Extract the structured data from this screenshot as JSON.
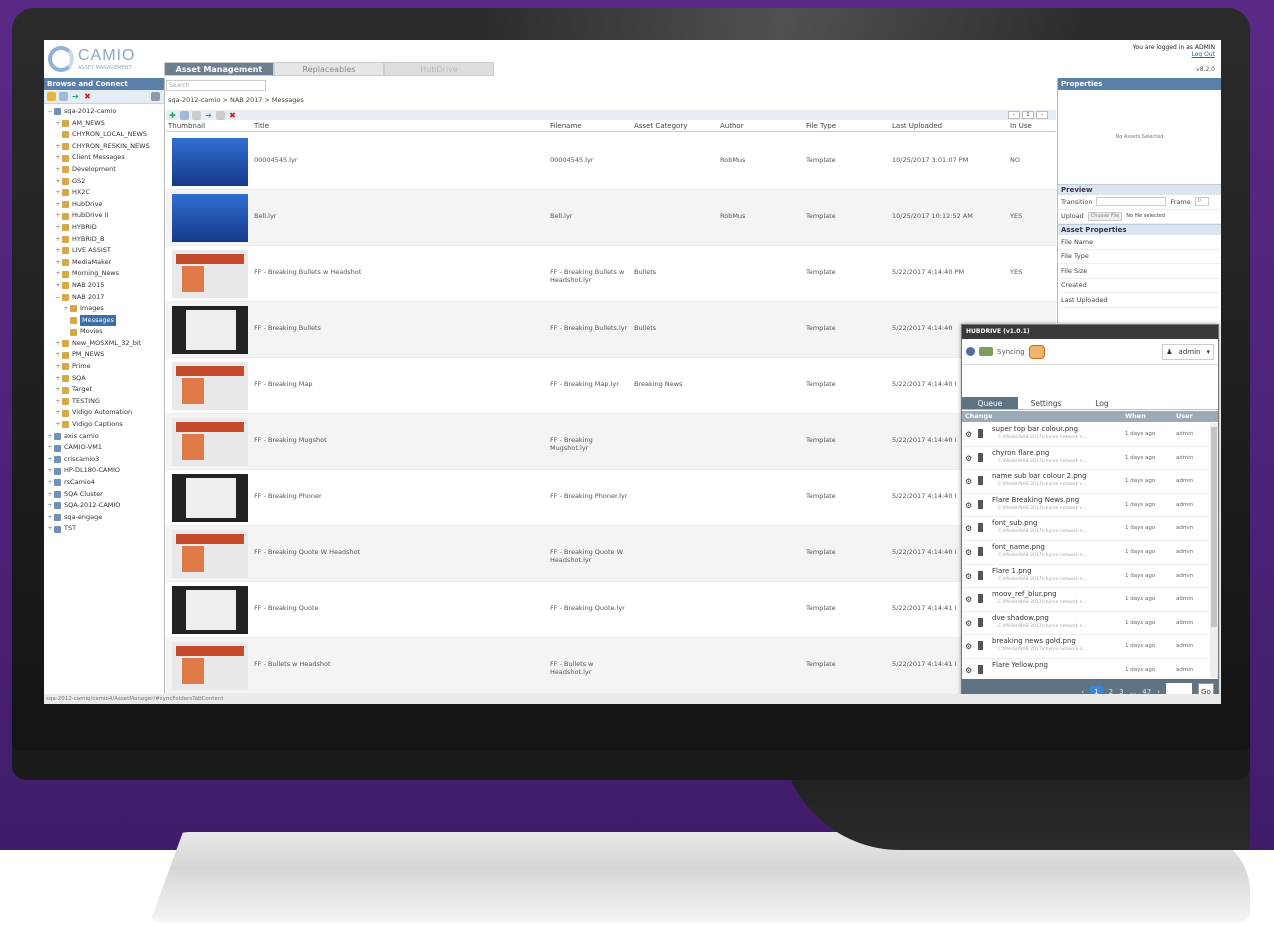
{
  "app": {
    "logo_name": "CAMIO",
    "logo_sub": "ASSET MANAGEMENT",
    "login_text": "You are logged in as ADMIN",
    "logout_label": "Log Out",
    "version": "v8.2.0"
  },
  "tabs": [
    {
      "label": "Asset Management"
    },
    {
      "label": "Replaceables"
    },
    {
      "label": "HubDrive"
    }
  ],
  "left_panel": {
    "title": "Browse and Connect",
    "tree": [
      {
        "label": "sqa-2012-camio",
        "level": 0,
        "type": "server",
        "exp": "−"
      },
      {
        "label": "AM_NEWS",
        "level": 1,
        "type": "folder",
        "exp": "+"
      },
      {
        "label": "CHYRON_LOCAL_NEWS",
        "level": 1,
        "type": "folder",
        "exp": ""
      },
      {
        "label": "CHYRON_RESKIN_NEWS",
        "level": 1,
        "type": "folder",
        "exp": "+"
      },
      {
        "label": "Client Messages",
        "level": 1,
        "type": "folder",
        "exp": "+"
      },
      {
        "label": "Development",
        "level": 1,
        "type": "folder",
        "exp": "+"
      },
      {
        "label": "GS2",
        "level": 1,
        "type": "folder",
        "exp": "+"
      },
      {
        "label": "HX2C",
        "level": 1,
        "type": "folder",
        "exp": "+"
      },
      {
        "label": "HubDrive",
        "level": 1,
        "type": "folder",
        "exp": "+"
      },
      {
        "label": "HubDrive II",
        "level": 1,
        "type": "folder",
        "exp": "+"
      },
      {
        "label": "HYBRID",
        "level": 1,
        "type": "folder",
        "exp": "+"
      },
      {
        "label": "HYBRID_B",
        "level": 1,
        "type": "folder",
        "exp": "+"
      },
      {
        "label": "LIVE ASSIST",
        "level": 1,
        "type": "folder",
        "exp": "+"
      },
      {
        "label": "MediaMaker",
        "level": 1,
        "type": "folder",
        "exp": "+"
      },
      {
        "label": "Morning_News",
        "level": 1,
        "type": "folder",
        "exp": "+"
      },
      {
        "label": "NAB 2015",
        "level": 1,
        "type": "folder",
        "exp": "+"
      },
      {
        "label": "NAB 2017",
        "level": 1,
        "type": "folder",
        "exp": "−"
      },
      {
        "label": "Images",
        "level": 2,
        "type": "folder",
        "exp": "+"
      },
      {
        "label": "Messages",
        "level": 2,
        "type": "folder",
        "exp": "",
        "selected": true
      },
      {
        "label": "Movies",
        "level": 2,
        "type": "folder",
        "exp": ""
      },
      {
        "label": "New_MOSXML_32_bit",
        "level": 1,
        "type": "folder",
        "exp": "+"
      },
      {
        "label": "PM_NEWS",
        "level": 1,
        "type": "folder",
        "exp": "+"
      },
      {
        "label": "Prime",
        "level": 1,
        "type": "folder",
        "exp": "+"
      },
      {
        "label": "SQA",
        "level": 1,
        "type": "folder",
        "exp": "+"
      },
      {
        "label": "Target",
        "level": 1,
        "type": "folder",
        "exp": "+"
      },
      {
        "label": "TESTING",
        "level": 1,
        "type": "folder",
        "exp": "+"
      },
      {
        "label": "Vidigo Automation",
        "level": 1,
        "type": "folder",
        "exp": "+"
      },
      {
        "label": "Vidigo Captions",
        "level": 1,
        "type": "folder",
        "exp": "+"
      },
      {
        "label": "axis camio",
        "level": 0,
        "type": "server",
        "exp": "+"
      },
      {
        "label": "CAMIO-VM1",
        "level": 0,
        "type": "server",
        "exp": "+"
      },
      {
        "label": "criscamio3",
        "level": 0,
        "type": "server",
        "exp": "+"
      },
      {
        "label": "HP-DL180-CAMIO",
        "level": 0,
        "type": "server",
        "exp": "+"
      },
      {
        "label": "rsCamio4",
        "level": 0,
        "type": "server",
        "exp": "+"
      },
      {
        "label": "SQA Cluster",
        "level": 0,
        "type": "server",
        "exp": "+"
      },
      {
        "label": "SQA-2012-CAMIO",
        "level": 0,
        "type": "server",
        "exp": "+"
      },
      {
        "label": "sqa-engage",
        "level": 0,
        "type": "server",
        "exp": "+"
      },
      {
        "label": "TST",
        "level": 0,
        "type": "server",
        "exp": "+"
      }
    ]
  },
  "center": {
    "search_placeholder": "Search",
    "breadcrumb": "sqa-2012-camio  >  NAB 2017  >  Messages",
    "columns": {
      "thumbnail": "Thumbnail",
      "title": "Title",
      "filename": "Filename",
      "category": "Asset Category",
      "author": "Author",
      "filetype": "File Type",
      "uploaded": "Last Uploaded",
      "inuse": "In Use"
    },
    "rows": [
      {
        "title": "00004545.lyr",
        "filename": "00004545.lyr",
        "category": "",
        "author": "RobMus",
        "filetype": "Template",
        "uploaded": "10/25/2017 3:01:07 PM",
        "inuse": "NO",
        "thumb": "blue"
      },
      {
        "title": "Bell.lyr",
        "filename": "Bell.lyr",
        "category": "",
        "author": "RobMus",
        "filetype": "Template",
        "uploaded": "10/25/2017 10:12:52 AM",
        "inuse": "YES",
        "thumb": "blue"
      },
      {
        "title": "FF - Breaking Bullets w Headshot",
        "filename": "FF - Breaking Bullets w Headshot.lyr",
        "category": "Bullets",
        "author": "",
        "filetype": "Template",
        "uploaded": "5/22/2017 4:14:40 PM",
        "inuse": "YES",
        "thumb": "tmpl"
      },
      {
        "title": "FF - Breaking Bullets",
        "filename": "FF - Breaking Bullets.lyr",
        "category": "Bullets",
        "author": "",
        "filetype": "Template",
        "uploaded": "5/22/2017 4:14:40",
        "inuse": "",
        "thumb": "dark"
      },
      {
        "title": "FF - Breaking Map",
        "filename": "FF - Breaking Map.lyr",
        "category": "Breaking News",
        "author": "",
        "filetype": "Template",
        "uploaded": "5/22/2017 4:14:40 I",
        "inuse": "",
        "thumb": "tmpl"
      },
      {
        "title": "FF - Breaking Mugshot",
        "filename": "FF - Breaking Mugshot.lyr",
        "category": "",
        "author": "",
        "filetype": "Template",
        "uploaded": "5/22/2017 4:14:40 I",
        "inuse": "",
        "thumb": "tmpl"
      },
      {
        "title": "FF - Breaking Phoner",
        "filename": "FF - Breaking Phoner.lyr",
        "category": "",
        "author": "",
        "filetype": "Template",
        "uploaded": "5/22/2017 4:14:40 I",
        "inuse": "",
        "thumb": "dark"
      },
      {
        "title": "FF - Breaking Quote W Headshot",
        "filename": "FF - Breaking Quote W Headshot.lyr",
        "category": "",
        "author": "",
        "filetype": "Template",
        "uploaded": "5/22/2017 4:14:40 I",
        "inuse": "",
        "thumb": "tmpl"
      },
      {
        "title": "FF - Breaking Quote",
        "filename": "FF - Breaking Quote.lyr",
        "category": "",
        "author": "",
        "filetype": "Template",
        "uploaded": "5/22/2017 4:14:41 I",
        "inuse": "",
        "thumb": "dark"
      },
      {
        "title": "FF - Bullets w Headshot",
        "filename": "FF - Bullets w Headshot.lyr",
        "category": "",
        "author": "",
        "filetype": "Template",
        "uploaded": "5/22/2017 4:14:41 I",
        "inuse": "",
        "thumb": "tmpl"
      }
    ]
  },
  "properties": {
    "title": "Properties",
    "empty": "No Assets Selected",
    "preview_title": "Preview",
    "transition_label": "Transition",
    "frame_label": "Frame",
    "frame_value": "0",
    "upload_label": "Upload",
    "choose_file": "Choose File",
    "no_file": "No file selected",
    "asset_props_title": "Asset Properties",
    "fields": [
      "File Name",
      "File Type",
      "File Size",
      "Created",
      "Last Uploaded"
    ]
  },
  "hubdrive": {
    "title": "HUBDRIVE (v1.0.1)",
    "sync_label": "Syncing",
    "user": "admin",
    "tabs": [
      "Queue",
      "Settings",
      "Log"
    ],
    "columns": {
      "change": "Change",
      "when": "When",
      "user": "User"
    },
    "items": [
      {
        "name": "super top bar colour.png",
        "path": "C:\\Media\\NAB 2017\\chyron network n...",
        "when": "1 days ago",
        "user": "admin"
      },
      {
        "name": "chyron flare.png",
        "path": "C:\\Media\\NAB 2017\\chyron network n...",
        "when": "1 days ago",
        "user": "admin"
      },
      {
        "name": "name sub bar colour 2.png",
        "path": "C:\\Media\\NAB 2017\\chyron network n...",
        "when": "1 days ago",
        "user": "admin"
      },
      {
        "name": "Flare Breaking News.png",
        "path": "C:\\Media\\NAB 2017\\chyron network n...",
        "when": "1 days ago",
        "user": "admin"
      },
      {
        "name": "font_sub.png",
        "path": "C:\\Media\\NAB 2017\\chyron network n...",
        "when": "1 days ago",
        "user": "admin"
      },
      {
        "name": "font_name.png",
        "path": "C:\\Media\\NAB 2017\\chyron network n...",
        "when": "1 days ago",
        "user": "admin"
      },
      {
        "name": "Flare 1.png",
        "path": "C:\\Media\\NAB 2017\\chyron network n...",
        "when": "1 days ago",
        "user": "admin"
      },
      {
        "name": "moov_ref_blur.png",
        "path": "C:\\Media\\NAB 2017\\chyron network n...",
        "when": "1 days ago",
        "user": "admin"
      },
      {
        "name": "dve shadow.png",
        "path": "C:\\Media\\NAB 2017\\chyron network n...",
        "when": "1 days ago",
        "user": "admin"
      },
      {
        "name": "breaking news gold.png",
        "path": "C:\\Media\\NAB 2017\\chyron network n...",
        "when": "1 days ago",
        "user": "admin"
      },
      {
        "name": "Flare Yellow.png",
        "path": "",
        "when": "1 days ago",
        "user": "admin"
      }
    ],
    "pager": {
      "prev": "‹",
      "pages": [
        "1",
        "2",
        "3",
        "...",
        "47"
      ],
      "next": "›",
      "go": "Go"
    }
  },
  "status_bar": "sqa-2012-camio/camio4/AssetManager/#syncFoldersTabContent",
  "colors": {
    "accent": "#5a7fa8",
    "selected": "#3c6ea8",
    "purple_bg": "#4a2176"
  }
}
